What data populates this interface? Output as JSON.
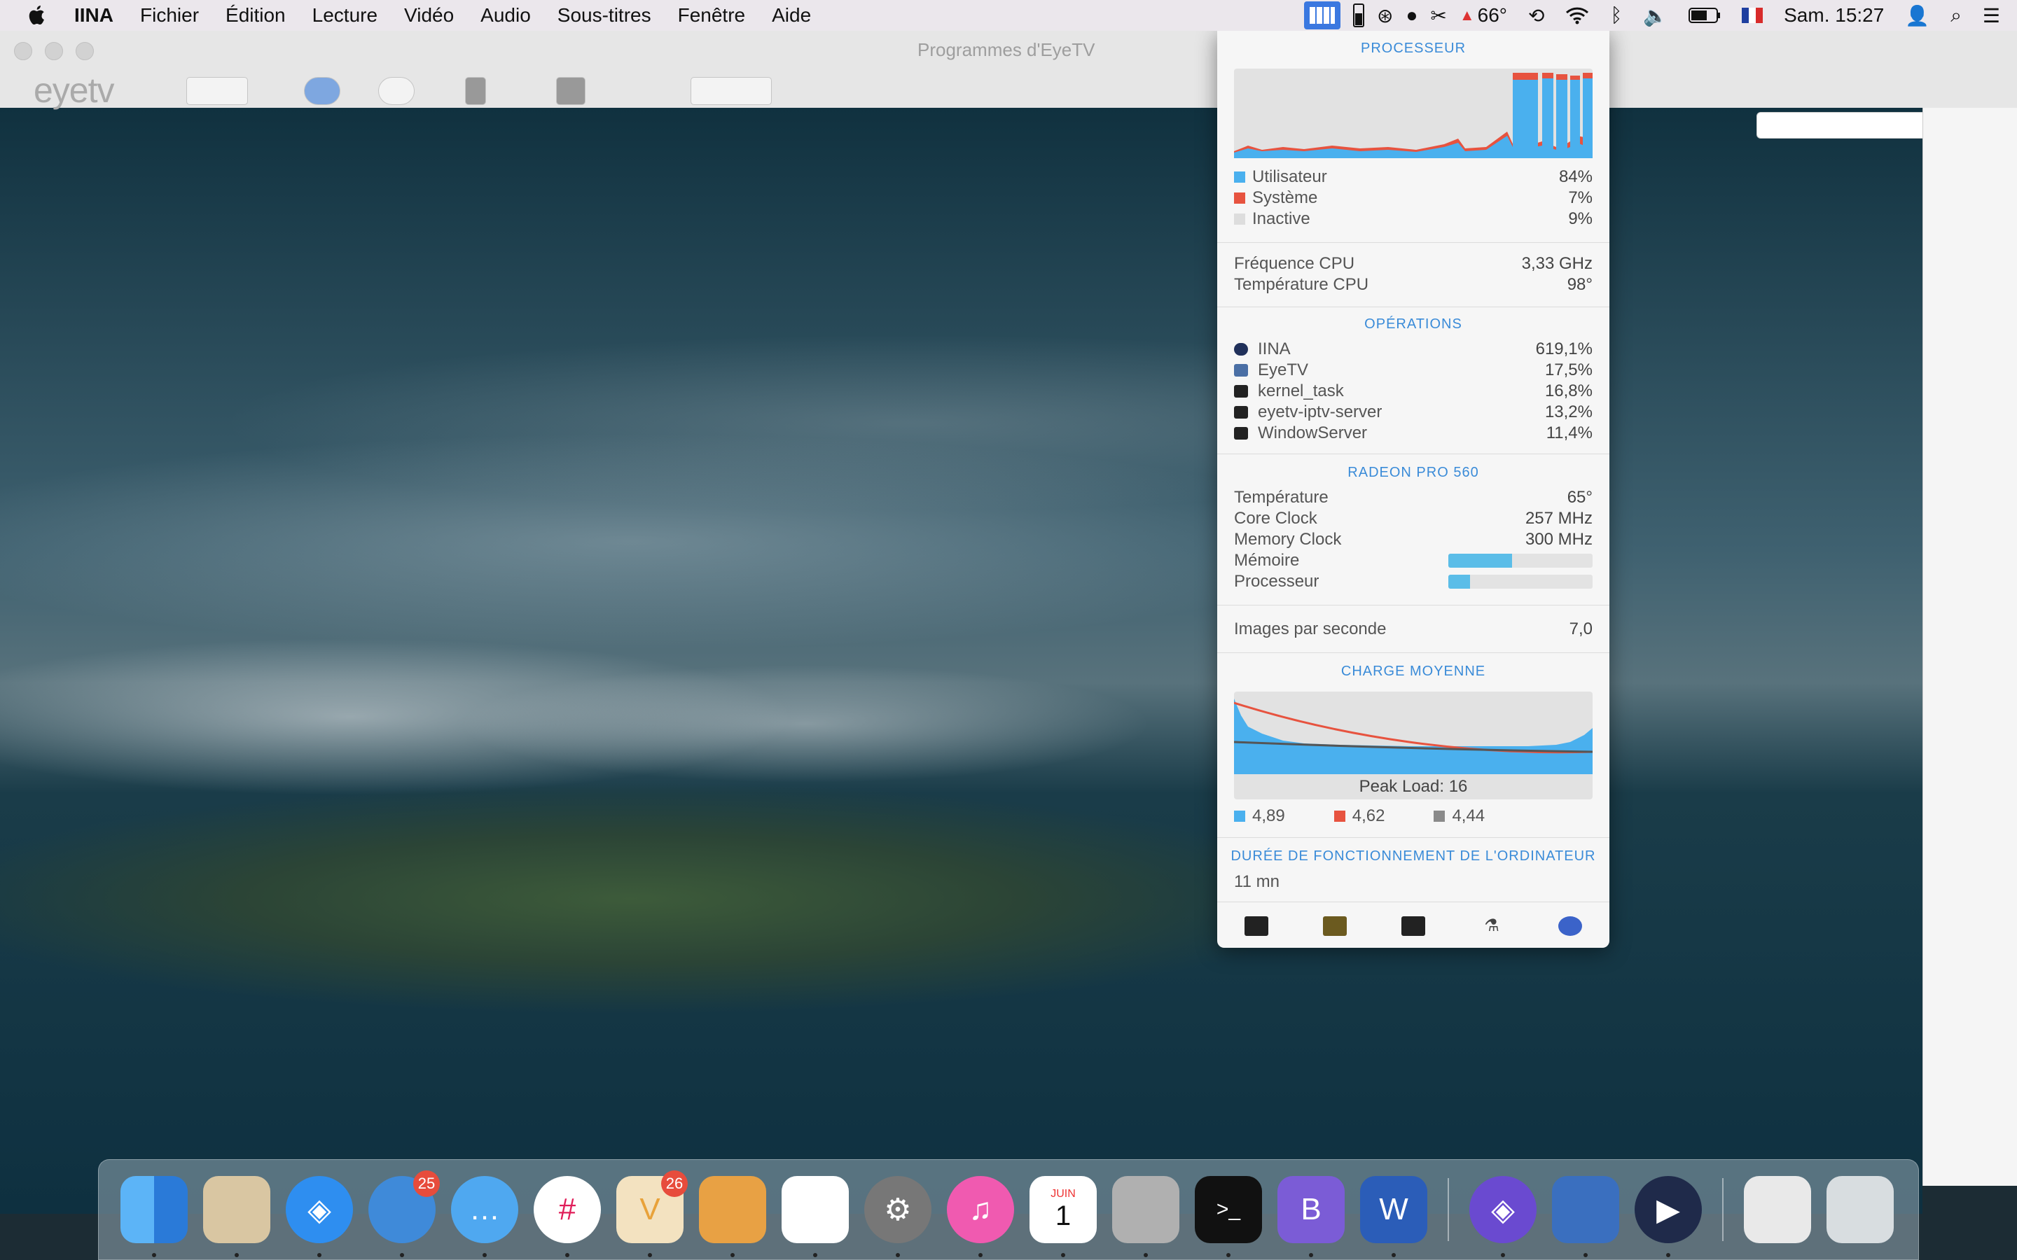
{
  "menubar": {
    "app_name": "IINA",
    "menus": [
      "Fichier",
      "Édition",
      "Lecture",
      "Vidéo",
      "Audio",
      "Sous-titres",
      "Fenêtre",
      "Aide"
    ],
    "status": {
      "temperature": "66°",
      "clock": "Sam. 15:27"
    }
  },
  "eyetv_window": {
    "title": "Programmes d'EyeTV",
    "logo": "eyetv"
  },
  "istat": {
    "processor": {
      "title": "PROCESSEUR",
      "legend": [
        {
          "label": "Utilisateur",
          "value": "84%",
          "color": "#4ab0ee"
        },
        {
          "label": "Système",
          "value": "7%",
          "color": "#e7533f"
        },
        {
          "label": "Inactive",
          "value": "9%",
          "color": "#dddddd"
        }
      ],
      "freq_label": "Fréquence CPU",
      "freq_value": "3,33 GHz",
      "temp_label": "Température CPU",
      "temp_value": "98°"
    },
    "operations": {
      "title": "OPÉRATIONS",
      "items": [
        {
          "name": "IINA",
          "value": "619,1%"
        },
        {
          "name": "EyeTV",
          "value": "17,5%"
        },
        {
          "name": "kernel_task",
          "value": "16,8%"
        },
        {
          "name": "eyetv-iptv-server",
          "value": "13,2%"
        },
        {
          "name": "WindowServer",
          "value": "11,4%"
        }
      ]
    },
    "gpu": {
      "title": "RADEON PRO 560",
      "temp_label": "Température",
      "temp_value": "65°",
      "core_label": "Core Clock",
      "core_value": "257 MHz",
      "mem_clock_label": "Memory Clock",
      "mem_clock_value": "300 MHz",
      "memory_label": "Mémoire",
      "memory_fraction": 0.44,
      "proc_label": "Processeur",
      "proc_fraction": 0.15
    },
    "fps": {
      "label": "Images par seconde",
      "value": "7,0"
    },
    "load": {
      "title": "CHARGE MOYENNE",
      "peak": "Peak Load: 16",
      "values": [
        {
          "value": "4,89",
          "color": "#4ab0ee"
        },
        {
          "value": "4,62",
          "color": "#e7533f"
        },
        {
          "value": "4,44",
          "color": "#8a8a8a"
        }
      ]
    },
    "uptime": {
      "title": "DURÉE DE FONCTIONNEMENT DE L'ORDINATEUR",
      "value": "11 mn"
    }
  },
  "dock": {
    "badges": {
      "tweetbot": "25",
      "vectorize": "26"
    },
    "calendar": {
      "month": "JUIN",
      "day": "1"
    }
  }
}
